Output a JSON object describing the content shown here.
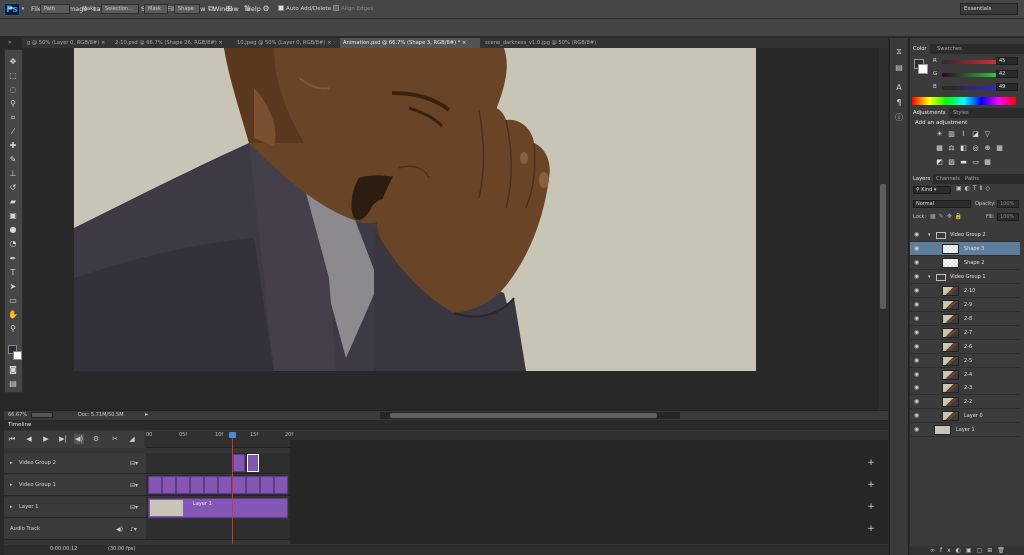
{
  "app": {
    "logo": "Ps"
  },
  "menu": [
    "File",
    "Edit",
    "Image",
    "Layer",
    "Type",
    "Select",
    "Filter",
    "View",
    "Window",
    "Help"
  ],
  "window_controls": [
    "–",
    "□",
    "✕"
  ],
  "options_bar": {
    "tool_icon": "pen-icon",
    "mode_value": "Path",
    "make_label": "Make:",
    "selection_button": "Selection...",
    "mask_button": "Mask",
    "shape_button": "Shape",
    "auto_add_delete": "Auto Add/Delete",
    "auto_add_delete_checked": true,
    "align_edges": "Align Edges",
    "align_edges_checked": false,
    "workspace": "Essentials"
  },
  "tabs": [
    {
      "label": "g @ 50% (Layer 0, RGB/8#)",
      "active": false
    },
    {
      "label": "2-10.psd @ 66.7% (Shape 26, RGB/8#)",
      "active": false
    },
    {
      "label": "10.jpeg @ 50% (Layer 0, RGB/8#)",
      "active": false
    },
    {
      "label": "Animation.psd @ 66.7% (Shape 3, RGB/8#) *",
      "active": true
    },
    {
      "label": "scene_darkness_v1.0.jpg @ 50% (RGB/8#)",
      "active": false
    }
  ],
  "status": {
    "zoom": "66.67%",
    "doc": "Doc: 5.71M/50.5M"
  },
  "timeline": {
    "title": "Timeline",
    "ruler": [
      "00",
      "05f",
      "10f",
      "15f",
      "20f"
    ],
    "playhead_frame": 12,
    "tracks": [
      {
        "name": "Video Group 2"
      },
      {
        "name": "Video Group 1"
      },
      {
        "name": "Layer 1",
        "clip_label": "Layer 1"
      },
      {
        "name": "Audio Track"
      }
    ],
    "bottom": {
      "timecode": "0:00:00:12",
      "fps": "(30.00 fps)"
    }
  },
  "color_panel": {
    "tabs": [
      "Color",
      "Swatches"
    ],
    "R": 45,
    "G": 42,
    "B": 49,
    "foreground": "#2d2a31",
    "background": "#ffffff"
  },
  "adjustments_panel": {
    "tabs": [
      "Adjustments",
      "Styles"
    ],
    "add_label": "Add an adjustment"
  },
  "layers_panel": {
    "tabs": [
      "Layers",
      "Channels",
      "Paths"
    ],
    "kind": "Kind",
    "blend_mode": "Normal",
    "opacity_label": "Opacity:",
    "opacity_value": "100%",
    "lock_label": "Lock:",
    "fill_label": "Fill:",
    "fill_value": "100%",
    "layers": [
      {
        "name": "Video Group 2",
        "type": "group",
        "indent": 0,
        "selected": false
      },
      {
        "name": "Shape 3",
        "type": "shape",
        "indent": 1,
        "selected": true
      },
      {
        "name": "Shape 2",
        "type": "shape",
        "indent": 1,
        "selected": false
      },
      {
        "name": "Video Group 1",
        "type": "group",
        "indent": 0,
        "selected": false
      },
      {
        "name": "2-10",
        "type": "frame",
        "indent": 1,
        "selected": false
      },
      {
        "name": "2-9",
        "type": "frame",
        "indent": 1,
        "selected": false
      },
      {
        "name": "2-8",
        "type": "frame",
        "indent": 1,
        "selected": false
      },
      {
        "name": "2-7",
        "type": "frame",
        "indent": 1,
        "selected": false
      },
      {
        "name": "2-6",
        "type": "frame",
        "indent": 1,
        "selected": false
      },
      {
        "name": "2-5",
        "type": "frame",
        "indent": 1,
        "selected": false
      },
      {
        "name": "2-4",
        "type": "frame",
        "indent": 1,
        "selected": false
      },
      {
        "name": "2-3",
        "type": "frame",
        "indent": 1,
        "selected": false
      },
      {
        "name": "2-2",
        "type": "frame",
        "indent": 1,
        "selected": false
      },
      {
        "name": "Layer 0",
        "type": "frame",
        "indent": 1,
        "selected": false
      },
      {
        "name": "Layer 1",
        "type": "fill",
        "indent": 0,
        "selected": false
      }
    ]
  },
  "colors": {
    "accent": "#8457b4",
    "playhead": "#d9312e",
    "selected_layer": "#5f7d9d",
    "canvas_bg": "#c9c5b6",
    "skin": "#6a4426",
    "suit": "#3e3a45"
  }
}
